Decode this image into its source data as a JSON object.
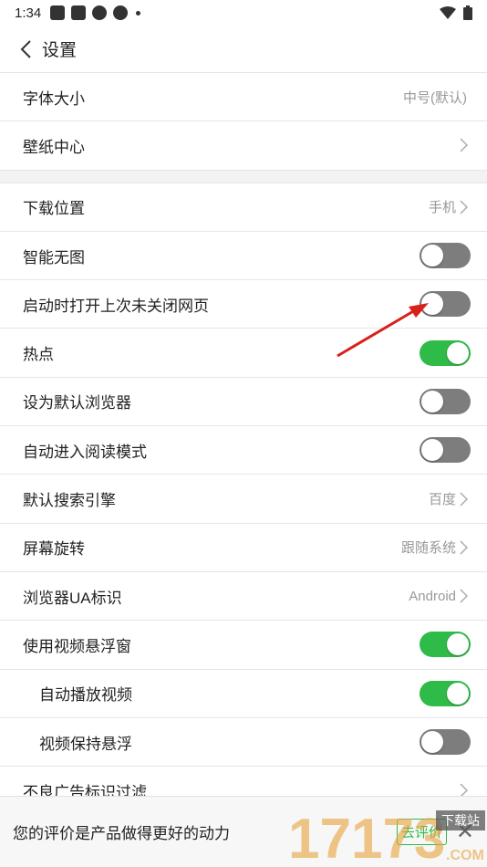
{
  "status": {
    "time": "1:34"
  },
  "header": {
    "title": "设置"
  },
  "rows": [
    {
      "label": "字体大小",
      "value": "中号(默认)"
    },
    {
      "label": "壁纸中心"
    },
    {
      "label": "下载位置",
      "value": "手机"
    },
    {
      "label": "智能无图",
      "toggle": false
    },
    {
      "label": "启动时打开上次未关闭网页",
      "toggle": false
    },
    {
      "label": "热点",
      "toggle": true
    },
    {
      "label": "设为默认浏览器",
      "toggle": false
    },
    {
      "label": "自动进入阅读模式",
      "toggle": false
    },
    {
      "label": "默认搜索引擎",
      "value": "百度"
    },
    {
      "label": "屏幕旋转",
      "value": "跟随系统"
    },
    {
      "label": "浏览器UA标识",
      "value": "Android"
    },
    {
      "label": "使用视频悬浮窗",
      "toggle": true
    },
    {
      "label": "自动播放视频",
      "toggle": true
    },
    {
      "label": "视频保持悬浮",
      "toggle": false
    },
    {
      "label": "不良广告标识过滤"
    }
  ],
  "bottom": {
    "text": "您的评价是产品做得更好的动力",
    "button": "去评价"
  },
  "watermark": {
    "text": "17173",
    "badge": "下载站",
    "domain": ".COM"
  },
  "colors": {
    "toggle_on": "#2fbb48",
    "toggle_off": "#7d7d7d",
    "arrow": "#d9201a"
  }
}
